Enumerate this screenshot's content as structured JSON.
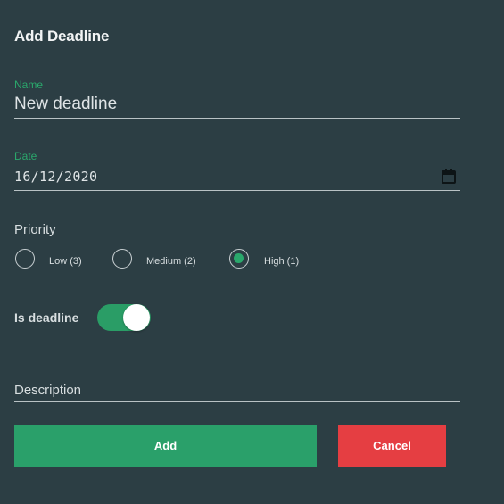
{
  "dialog": {
    "title": "Add Deadline"
  },
  "name_field": {
    "label": "Name",
    "value": "New deadline"
  },
  "date_field": {
    "label": "Date",
    "value": "16/12/2020",
    "icon": "calendar-icon"
  },
  "priority": {
    "label": "Priority",
    "options": [
      {
        "label": "Low (3)",
        "checked": false
      },
      {
        "label": "Medium (2)",
        "checked": false
      },
      {
        "label": "High (1)",
        "checked": true
      }
    ]
  },
  "deadline_toggle": {
    "label": "Is deadline",
    "on": true
  },
  "description_field": {
    "placeholder": "Description",
    "value": ""
  },
  "actions": {
    "add_label": "Add",
    "cancel_label": "Cancel"
  },
  "colors": {
    "background": "#2c3e44",
    "accent": "#2aa86c",
    "add_button": "#2aa06a",
    "cancel_button": "#e53e42"
  }
}
